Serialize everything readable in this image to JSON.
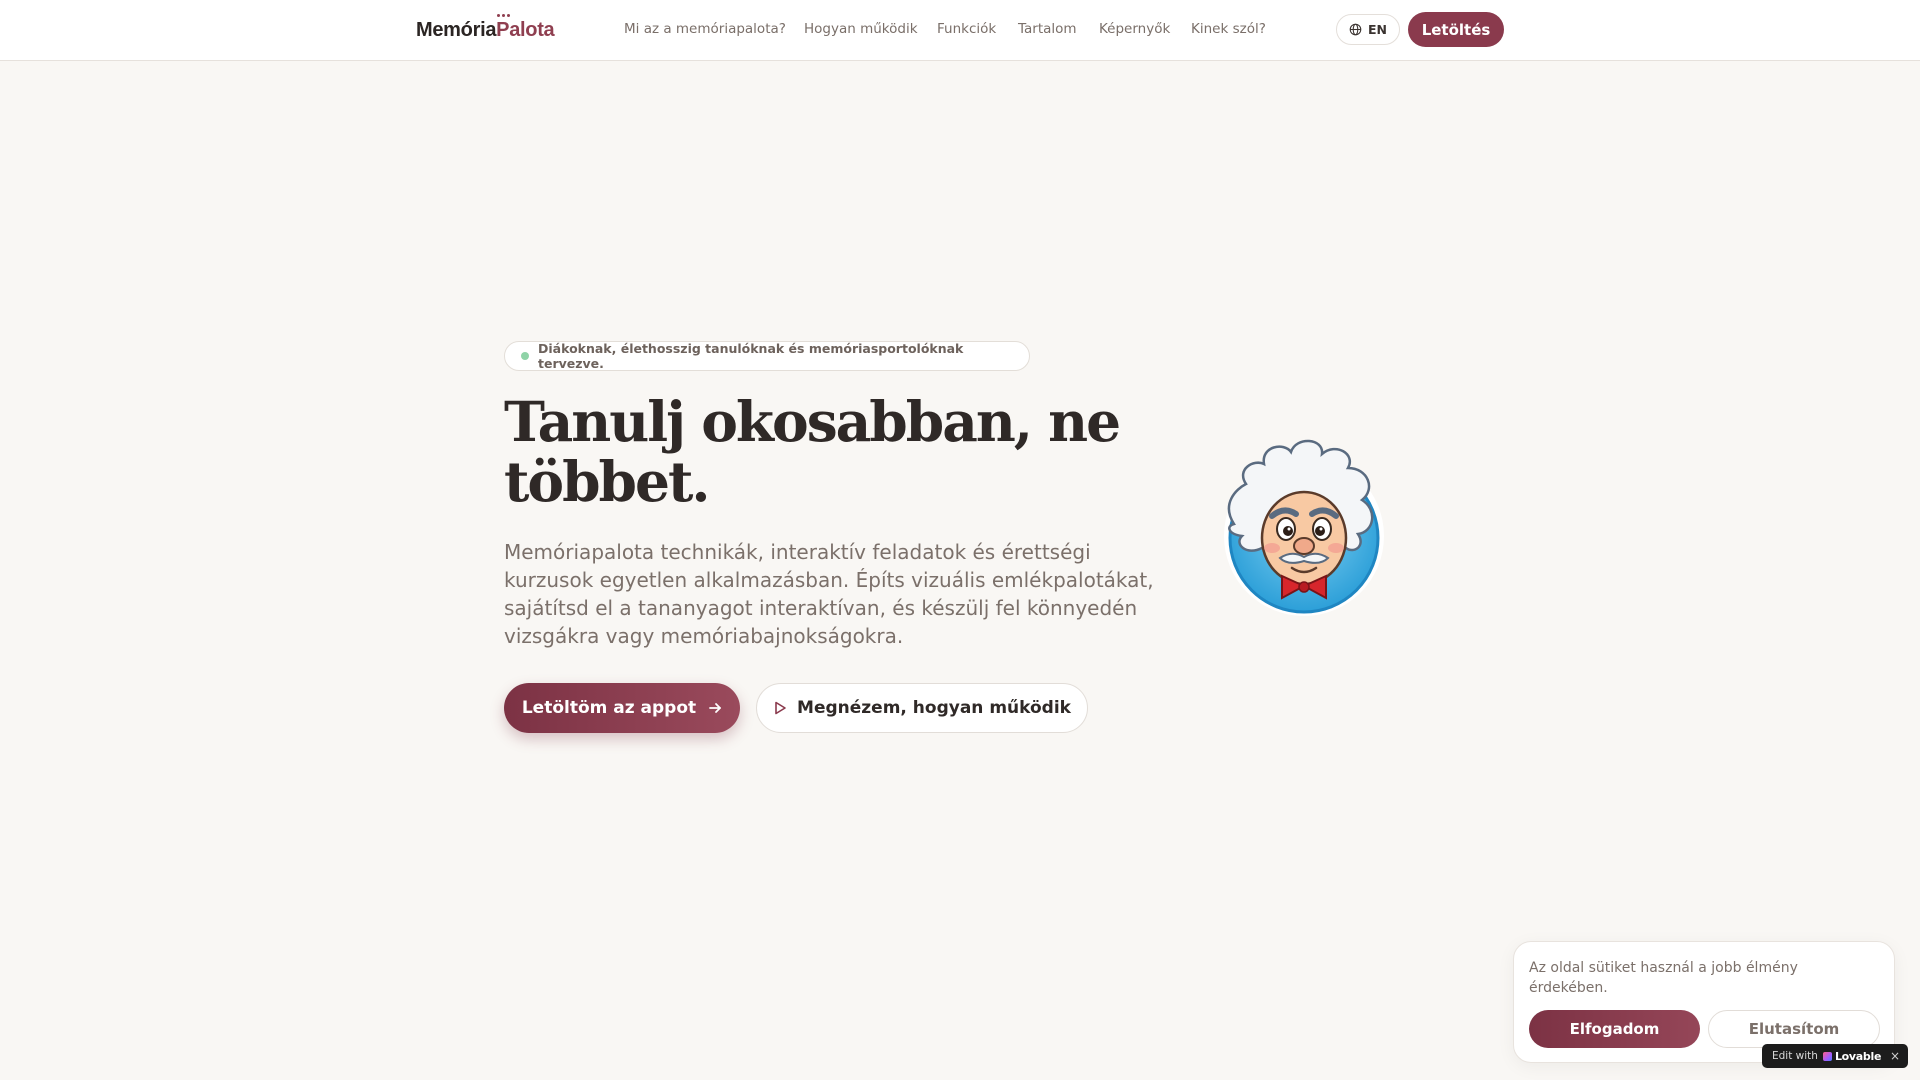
{
  "header": {
    "logo_part1": "Memória",
    "logo_part2": "Palota",
    "nav": [
      {
        "label": "Mi az a memóriapalota?"
      },
      {
        "label": "Hogyan működik"
      },
      {
        "label": "Funkciók"
      },
      {
        "label": "Tartalom"
      },
      {
        "label": "Képernyők"
      },
      {
        "label": "Kinek szól?"
      }
    ],
    "language": "EN",
    "language_icon": "globe-icon",
    "download_label": "Letöltés"
  },
  "hero": {
    "badge": "Diákoknak, élethosszig tanulóknak és memóriasportolóknak tervezve.",
    "title": "Tanulj okosabban, ne többet.",
    "text": "Memóriapalota technikák, interaktív feladatok és érettségi kurzusok egyetlen alkalmazásban. Építs vizuális emlékpalotákat, sajátítsd el a tananyagot interaktívan, és készülj fel könnyedén vizsgákra vagy memóriabajnokságokra.",
    "primary_cta": "Letöltöm az appot",
    "secondary_cta": "Megnézem, hogyan működik",
    "mascot_icon": "professor-mascot-icon"
  },
  "cookie": {
    "text": "Az oldal sütiket használ a jobb élmény érdekében.",
    "accept": "Elfogadom",
    "reject": "Elutasítom"
  },
  "lovable": {
    "prefix": "Edit with",
    "brand": "Lovable",
    "close": "×"
  },
  "colors": {
    "accent": "#8a3a4d",
    "background": "#f9f7f4",
    "badge_dot": "#8fd3a7"
  }
}
